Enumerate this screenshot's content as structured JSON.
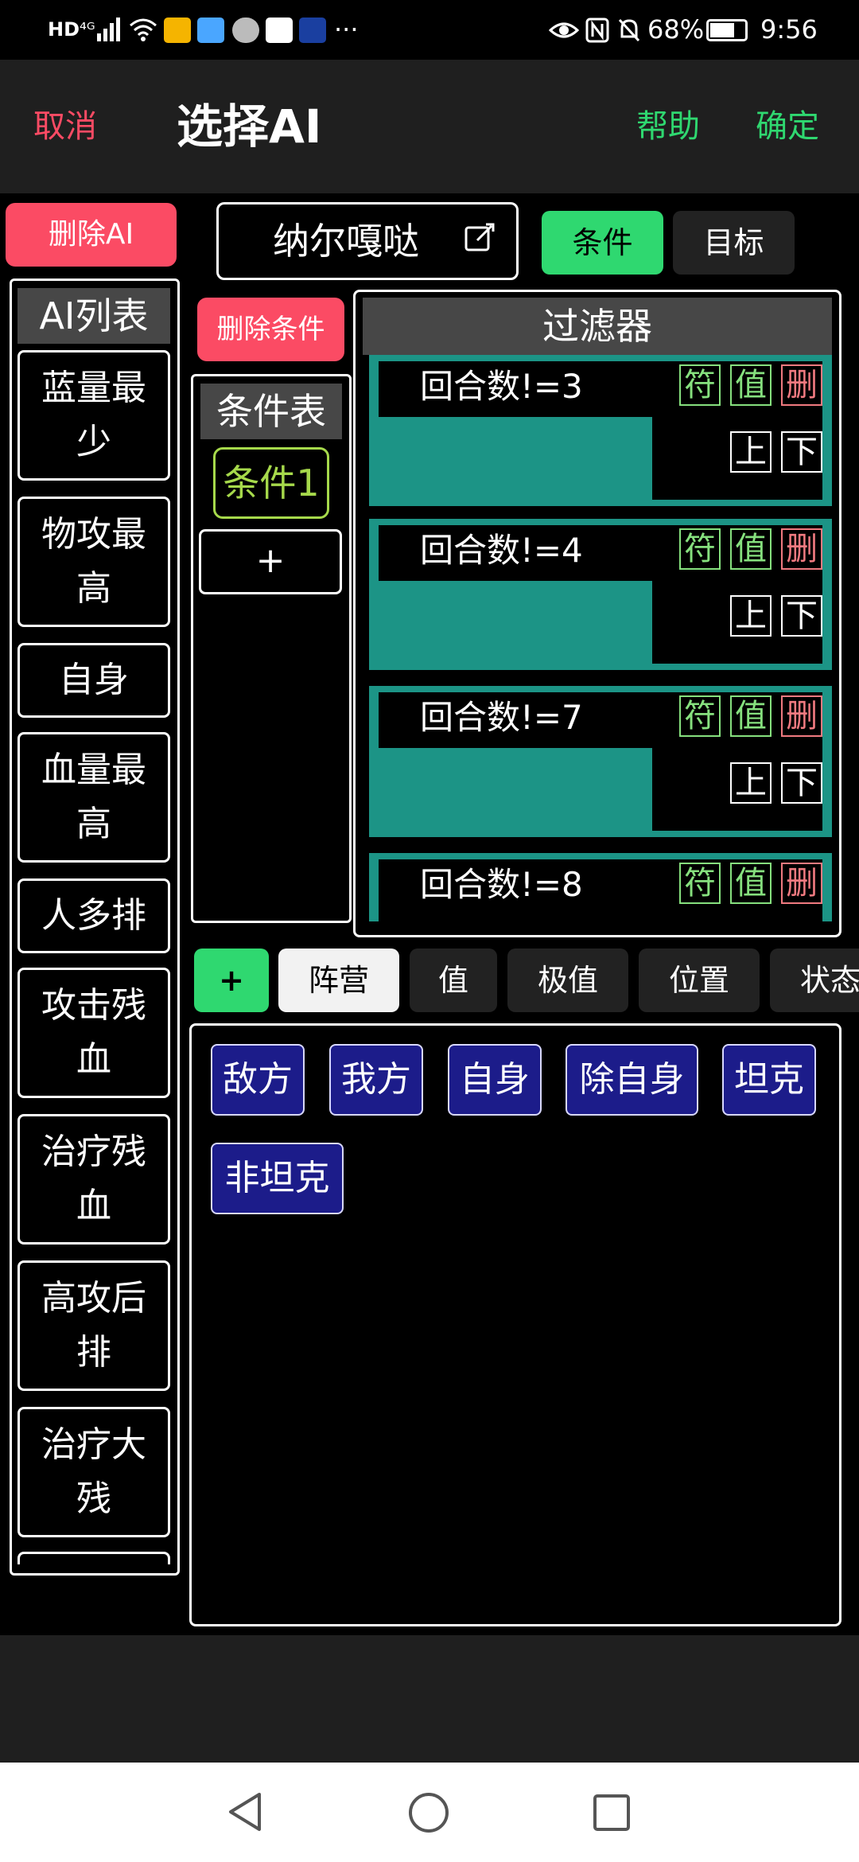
{
  "status_bar": {
    "left_network": "HD",
    "left_signal": "⁴ᴳ",
    "right_battery": "68%",
    "right_time": "9:56",
    "more": "···"
  },
  "header": {
    "cancel": "取消",
    "title": "选择AI",
    "help": "帮助",
    "confirm": "确定"
  },
  "delete_ai": "删除AI",
  "name_field": {
    "value": "纳尔嘎哒"
  },
  "mode_tabs": [
    "条件",
    "目标"
  ],
  "ai_list": {
    "title": "AI列表",
    "items": [
      "蓝量最少",
      "物攻最高",
      "自身",
      "血量最高",
      "人多排",
      "攻击残血",
      "治疗残血",
      "高攻后排",
      "治疗大残"
    ]
  },
  "delete_condition": "删除条件",
  "condition_table": {
    "title": "条件表",
    "items": [
      "条件1"
    ],
    "add": "+"
  },
  "filter": {
    "title": "过滤器",
    "cards": [
      {
        "label": "回合数!=3"
      },
      {
        "label": "回合数!=4"
      },
      {
        "label": "回合数!=7"
      },
      {
        "label": "回合数!=8"
      }
    ],
    "buttons": {
      "symbol": "符",
      "value": "值",
      "delete": "删",
      "up": "上",
      "down": "下"
    }
  },
  "bottom_tabs": {
    "add": "+",
    "items": [
      "阵营",
      "值",
      "极值",
      "位置",
      "状态"
    ]
  },
  "camp_options": [
    "敌方",
    "我方",
    "自身",
    "除自身",
    "坦克",
    "非坦克"
  ],
  "colors": {
    "red": "#fb4b64",
    "green": "#2fd870",
    "teal": "#1c9486",
    "navy_chip": "#1c1c8a"
  }
}
